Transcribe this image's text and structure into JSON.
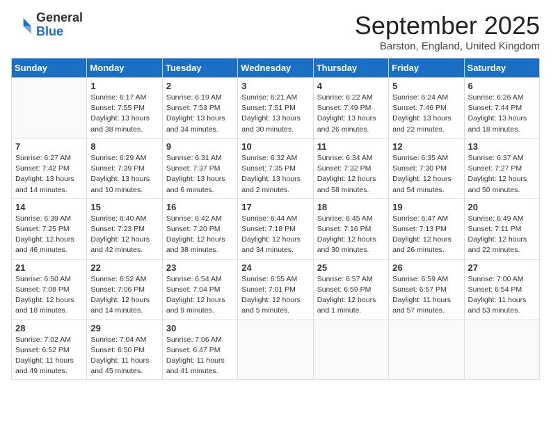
{
  "logo": {
    "general": "General",
    "blue": "Blue"
  },
  "title": "September 2025",
  "location": "Barston, England, United Kingdom",
  "days_of_week": [
    "Sunday",
    "Monday",
    "Tuesday",
    "Wednesday",
    "Thursday",
    "Friday",
    "Saturday"
  ],
  "weeks": [
    [
      {
        "day": "",
        "sunrise": "",
        "sunset": "",
        "daylight": ""
      },
      {
        "day": "1",
        "sunrise": "Sunrise: 6:17 AM",
        "sunset": "Sunset: 7:55 PM",
        "daylight": "Daylight: 13 hours and 38 minutes."
      },
      {
        "day": "2",
        "sunrise": "Sunrise: 6:19 AM",
        "sunset": "Sunset: 7:53 PM",
        "daylight": "Daylight: 13 hours and 34 minutes."
      },
      {
        "day": "3",
        "sunrise": "Sunrise: 6:21 AM",
        "sunset": "Sunset: 7:51 PM",
        "daylight": "Daylight: 13 hours and 30 minutes."
      },
      {
        "day": "4",
        "sunrise": "Sunrise: 6:22 AM",
        "sunset": "Sunset: 7:49 PM",
        "daylight": "Daylight: 13 hours and 26 minutes."
      },
      {
        "day": "5",
        "sunrise": "Sunrise: 6:24 AM",
        "sunset": "Sunset: 7:46 PM",
        "daylight": "Daylight: 13 hours and 22 minutes."
      },
      {
        "day": "6",
        "sunrise": "Sunrise: 6:26 AM",
        "sunset": "Sunset: 7:44 PM",
        "daylight": "Daylight: 13 hours and 18 minutes."
      }
    ],
    [
      {
        "day": "7",
        "sunrise": "Sunrise: 6:27 AM",
        "sunset": "Sunset: 7:42 PM",
        "daylight": "Daylight: 13 hours and 14 minutes."
      },
      {
        "day": "8",
        "sunrise": "Sunrise: 6:29 AM",
        "sunset": "Sunset: 7:39 PM",
        "daylight": "Daylight: 13 hours and 10 minutes."
      },
      {
        "day": "9",
        "sunrise": "Sunrise: 6:31 AM",
        "sunset": "Sunset: 7:37 PM",
        "daylight": "Daylight: 13 hours and 6 minutes."
      },
      {
        "day": "10",
        "sunrise": "Sunrise: 6:32 AM",
        "sunset": "Sunset: 7:35 PM",
        "daylight": "Daylight: 13 hours and 2 minutes."
      },
      {
        "day": "11",
        "sunrise": "Sunrise: 6:34 AM",
        "sunset": "Sunset: 7:32 PM",
        "daylight": "Daylight: 12 hours and 58 minutes."
      },
      {
        "day": "12",
        "sunrise": "Sunrise: 6:35 AM",
        "sunset": "Sunset: 7:30 PM",
        "daylight": "Daylight: 12 hours and 54 minutes."
      },
      {
        "day": "13",
        "sunrise": "Sunrise: 6:37 AM",
        "sunset": "Sunset: 7:27 PM",
        "daylight": "Daylight: 12 hours and 50 minutes."
      }
    ],
    [
      {
        "day": "14",
        "sunrise": "Sunrise: 6:39 AM",
        "sunset": "Sunset: 7:25 PM",
        "daylight": "Daylight: 12 hours and 46 minutes."
      },
      {
        "day": "15",
        "sunrise": "Sunrise: 6:40 AM",
        "sunset": "Sunset: 7:23 PM",
        "daylight": "Daylight: 12 hours and 42 minutes."
      },
      {
        "day": "16",
        "sunrise": "Sunrise: 6:42 AM",
        "sunset": "Sunset: 7:20 PM",
        "daylight": "Daylight: 12 hours and 38 minutes."
      },
      {
        "day": "17",
        "sunrise": "Sunrise: 6:44 AM",
        "sunset": "Sunset: 7:18 PM",
        "daylight": "Daylight: 12 hours and 34 minutes."
      },
      {
        "day": "18",
        "sunrise": "Sunrise: 6:45 AM",
        "sunset": "Sunset: 7:16 PM",
        "daylight": "Daylight: 12 hours and 30 minutes."
      },
      {
        "day": "19",
        "sunrise": "Sunrise: 6:47 AM",
        "sunset": "Sunset: 7:13 PM",
        "daylight": "Daylight: 12 hours and 26 minutes."
      },
      {
        "day": "20",
        "sunrise": "Sunrise: 6:49 AM",
        "sunset": "Sunset: 7:11 PM",
        "daylight": "Daylight: 12 hours and 22 minutes."
      }
    ],
    [
      {
        "day": "21",
        "sunrise": "Sunrise: 6:50 AM",
        "sunset": "Sunset: 7:08 PM",
        "daylight": "Daylight: 12 hours and 18 minutes."
      },
      {
        "day": "22",
        "sunrise": "Sunrise: 6:52 AM",
        "sunset": "Sunset: 7:06 PM",
        "daylight": "Daylight: 12 hours and 14 minutes."
      },
      {
        "day": "23",
        "sunrise": "Sunrise: 6:54 AM",
        "sunset": "Sunset: 7:04 PM",
        "daylight": "Daylight: 12 hours and 9 minutes."
      },
      {
        "day": "24",
        "sunrise": "Sunrise: 6:55 AM",
        "sunset": "Sunset: 7:01 PM",
        "daylight": "Daylight: 12 hours and 5 minutes."
      },
      {
        "day": "25",
        "sunrise": "Sunrise: 6:57 AM",
        "sunset": "Sunset: 6:59 PM",
        "daylight": "Daylight: 12 hours and 1 minute."
      },
      {
        "day": "26",
        "sunrise": "Sunrise: 6:59 AM",
        "sunset": "Sunset: 6:57 PM",
        "daylight": "Daylight: 11 hours and 57 minutes."
      },
      {
        "day": "27",
        "sunrise": "Sunrise: 7:00 AM",
        "sunset": "Sunset: 6:54 PM",
        "daylight": "Daylight: 11 hours and 53 minutes."
      }
    ],
    [
      {
        "day": "28",
        "sunrise": "Sunrise: 7:02 AM",
        "sunset": "Sunset: 6:52 PM",
        "daylight": "Daylight: 11 hours and 49 minutes."
      },
      {
        "day": "29",
        "sunrise": "Sunrise: 7:04 AM",
        "sunset": "Sunset: 6:50 PM",
        "daylight": "Daylight: 11 hours and 45 minutes."
      },
      {
        "day": "30",
        "sunrise": "Sunrise: 7:06 AM",
        "sunset": "Sunset: 6:47 PM",
        "daylight": "Daylight: 11 hours and 41 minutes."
      },
      {
        "day": "",
        "sunrise": "",
        "sunset": "",
        "daylight": ""
      },
      {
        "day": "",
        "sunrise": "",
        "sunset": "",
        "daylight": ""
      },
      {
        "day": "",
        "sunrise": "",
        "sunset": "",
        "daylight": ""
      },
      {
        "day": "",
        "sunrise": "",
        "sunset": "",
        "daylight": ""
      }
    ]
  ]
}
